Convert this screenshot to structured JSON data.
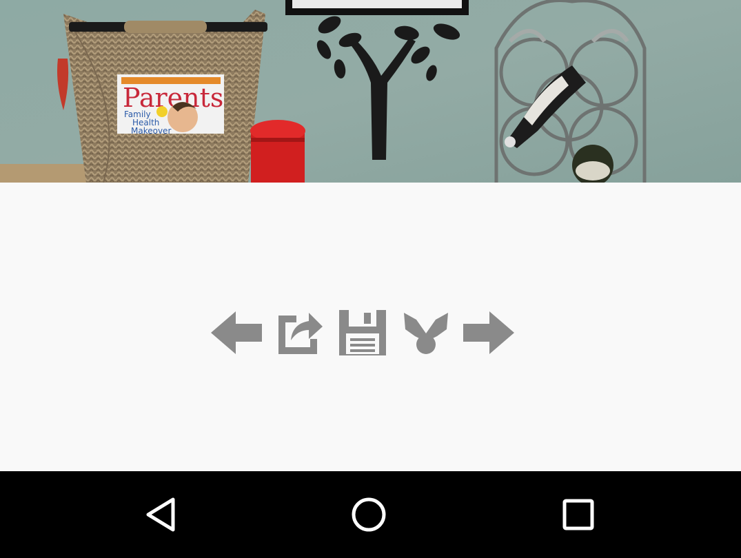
{
  "screen": {
    "photo": {
      "magazine_title": "Parents",
      "magazine_cover_lines": [
        "Family",
        "Health",
        "Makeover"
      ]
    }
  },
  "toolbar": {
    "buttons": [
      {
        "id": "previous",
        "icon": "arrow-left-icon"
      },
      {
        "id": "share",
        "icon": "share-icon"
      },
      {
        "id": "save",
        "icon": "floppy-disk-icon"
      },
      {
        "id": "set-as",
        "icon": "set-as-icon"
      },
      {
        "id": "next",
        "icon": "arrow-right-icon"
      }
    ],
    "icon_color": "#8a8a8a"
  },
  "system_nav": {
    "buttons": [
      {
        "id": "back",
        "icon": "back-triangle-icon"
      },
      {
        "id": "home",
        "icon": "home-circle-icon"
      },
      {
        "id": "recents",
        "icon": "recents-square-icon"
      }
    ],
    "background": "#000000",
    "icon_color": "#ffffff"
  }
}
